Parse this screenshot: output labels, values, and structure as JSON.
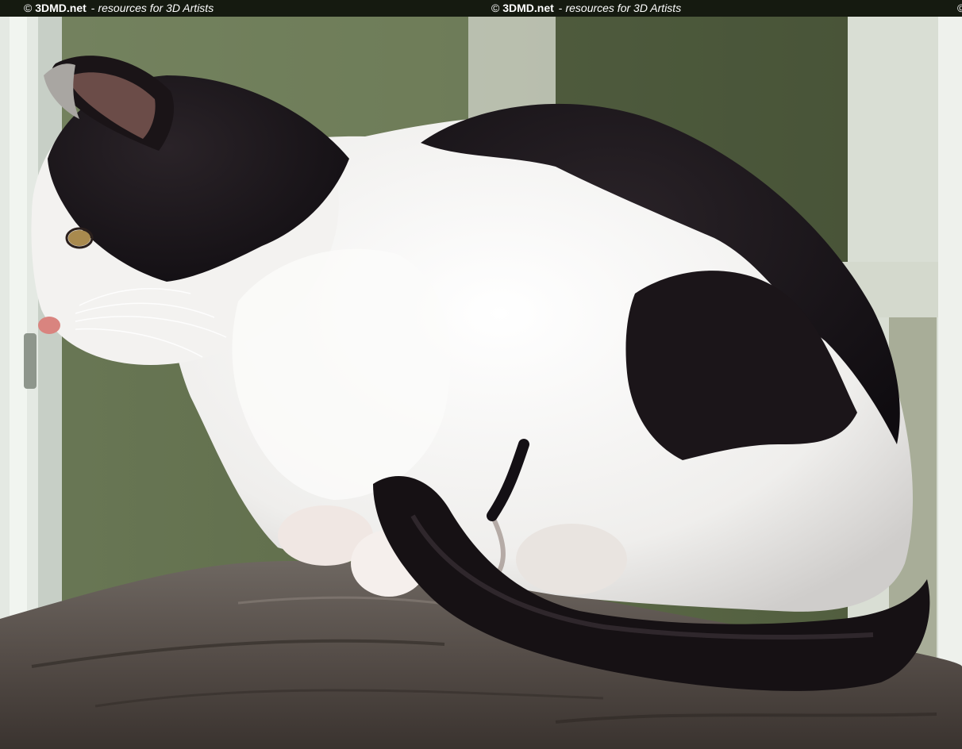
{
  "watermark": {
    "copyright": "©",
    "brand": "3DMD.net",
    "separator": "-",
    "tagline": "resources for 3D Artists"
  },
  "photo": {
    "colors": {
      "background_green": "#5d6a4a",
      "window_frame": "#dfe5dc",
      "fur_black": "#141015",
      "fur_white": "#f1f0ef",
      "branch_bark": "#5a524e",
      "nose_pink": "#d9847f"
    }
  }
}
